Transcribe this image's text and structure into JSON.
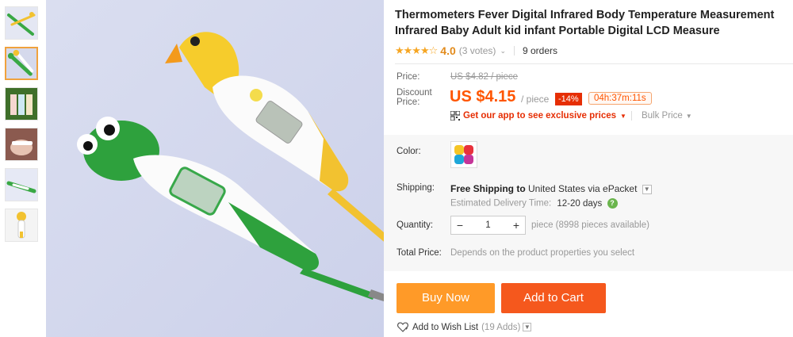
{
  "product": {
    "title": "Thermometers Fever Digital Infrared Body Temperature Measurement Infrared Baby Adult kid infant Portable Digital LCD Measure",
    "rating": {
      "stars": "★★★★☆",
      "value": "4.0",
      "votes": "(3 votes)",
      "orders": "9 orders"
    }
  },
  "price": {
    "price_label": "Price:",
    "original": "US $4.82 / piece",
    "discount_label_1": "Discount",
    "discount_label_2": "Price:",
    "discounted": "US $4.15",
    "per_unit": "/ piece",
    "discount_badge": "-14%",
    "countdown": "04h:37m:11s",
    "app_promo": "Get our app to see exclusive prices",
    "bulk_price": "Bulk Price"
  },
  "options": {
    "color_label": "Color:",
    "shipping_label": "Shipping:",
    "shipping_text_bold": "Free Shipping to",
    "shipping_text_rest": " United States via ePacket",
    "delivery_label": "Estimated Delivery Time:",
    "delivery_days": "12-20 days",
    "help_icon_text": "?",
    "quantity_label": "Quantity:",
    "quantity_value": "1",
    "quantity_minus": "−",
    "quantity_plus": "+",
    "quantity_info": "piece (8998 pieces available)",
    "total_label": "Total Price:",
    "total_info": "Depends on the product properties you select"
  },
  "actions": {
    "buy_now": "Buy Now",
    "add_to_cart": "Add to Cart",
    "wishlist": "Add to Wish List",
    "wishlist_count": "(19 Adds)"
  },
  "colors": {
    "price_accent": "#ff5500",
    "buy_now_bg": "#ff9a28",
    "add_to_cart_bg": "#f5581d",
    "badge_bg": "#e62e04",
    "star": "#f6a623"
  }
}
